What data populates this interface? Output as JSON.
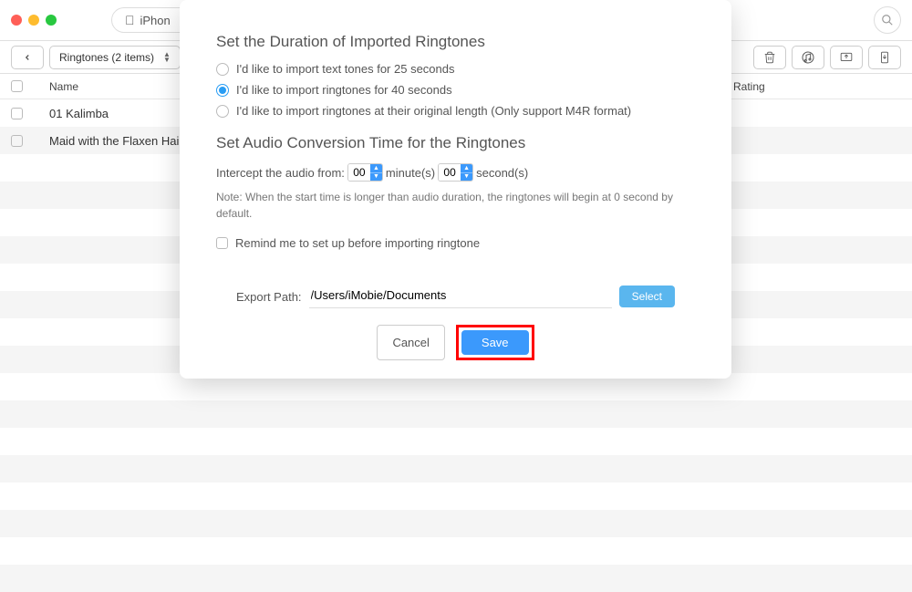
{
  "topbar": {
    "device_name": "iPhon"
  },
  "secondbar": {
    "dropdown_label": "Ringtones (2 items)"
  },
  "table": {
    "columns": {
      "name": "Name",
      "rating": "Rating"
    },
    "rows": [
      {
        "name": "01 Kalimba"
      },
      {
        "name": "Maid with the Flaxen Hair"
      }
    ]
  },
  "modal": {
    "section1_title": "Set the Duration of Imported Ringtones",
    "options": [
      "I'd like to import text tones for 25 seconds",
      "I'd like to import ringtones for 40 seconds",
      "I'd like to import ringtones at their original length (Only support M4R format)"
    ],
    "section2_title": "Set Audio Conversion Time for the Ringtones",
    "intercept_label": "Intercept the audio from:",
    "minute_value": "00",
    "minute_label": "minute(s)",
    "second_value": "00",
    "second_label": "second(s)",
    "note": "Note: When the start time is longer than audio duration, the ringtones will begin at 0 second by default.",
    "remind_label": "Remind me to set up before importing ringtone",
    "export_label": "Export Path:",
    "export_path": "/Users/iMobie/Documents",
    "select_btn": "Select",
    "cancel_btn": "Cancel",
    "save_btn": "Save"
  }
}
